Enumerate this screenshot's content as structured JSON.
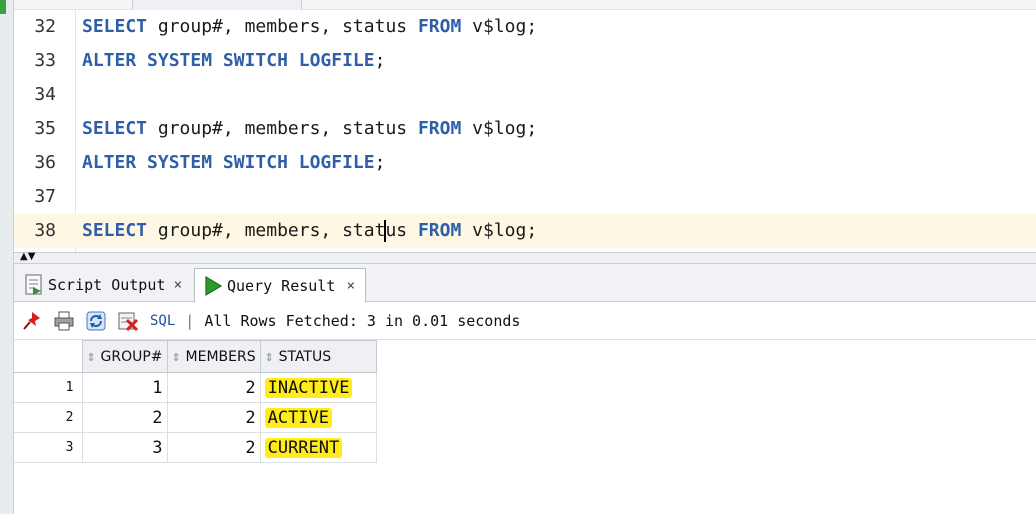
{
  "editor": {
    "lines": [
      {
        "num": "32",
        "kw1": "SELECT",
        "mid": " group#, members, status ",
        "kw2": "FROM",
        "tail": " v$log;"
      },
      {
        "num": "33",
        "kw1": "ALTER SYSTEM SWITCH LOGFILE",
        "tail": ";"
      },
      {
        "num": "34"
      },
      {
        "num": "35",
        "kw1": "SELECT",
        "mid": " group#, members, status ",
        "kw2": "FROM",
        "tail": " v$log;"
      },
      {
        "num": "36",
        "kw1": "ALTER SYSTEM SWITCH LOGFILE",
        "tail": ";"
      },
      {
        "num": "37"
      },
      {
        "num": "38",
        "kw1": "SELECT",
        "mid_a": " group#, members, stat",
        "mid_b": "us ",
        "kw2": "FROM",
        "tail": " v$log;"
      }
    ]
  },
  "tabs": {
    "script_output": "Script Output",
    "query_result": "Query Result",
    "close": "×"
  },
  "toolbar": {
    "sql_label": "SQL",
    "separator": "|",
    "status": "All Rows Fetched: 3 in 0.01 seconds"
  },
  "grid": {
    "columns": [
      "GROUP#",
      "MEMBERS",
      "STATUS"
    ],
    "rows": [
      {
        "row": "1",
        "group": "1",
        "members": "2",
        "status": "INACTIVE"
      },
      {
        "row": "2",
        "group": "2",
        "members": "2",
        "status": "ACTIVE"
      },
      {
        "row": "3",
        "group": "3",
        "members": "2",
        "status": "CURRENT"
      }
    ]
  },
  "colors": {
    "keyword": "#2f5fa8",
    "highlight": "#ffec1a",
    "current_line": "#fdf7e3"
  }
}
